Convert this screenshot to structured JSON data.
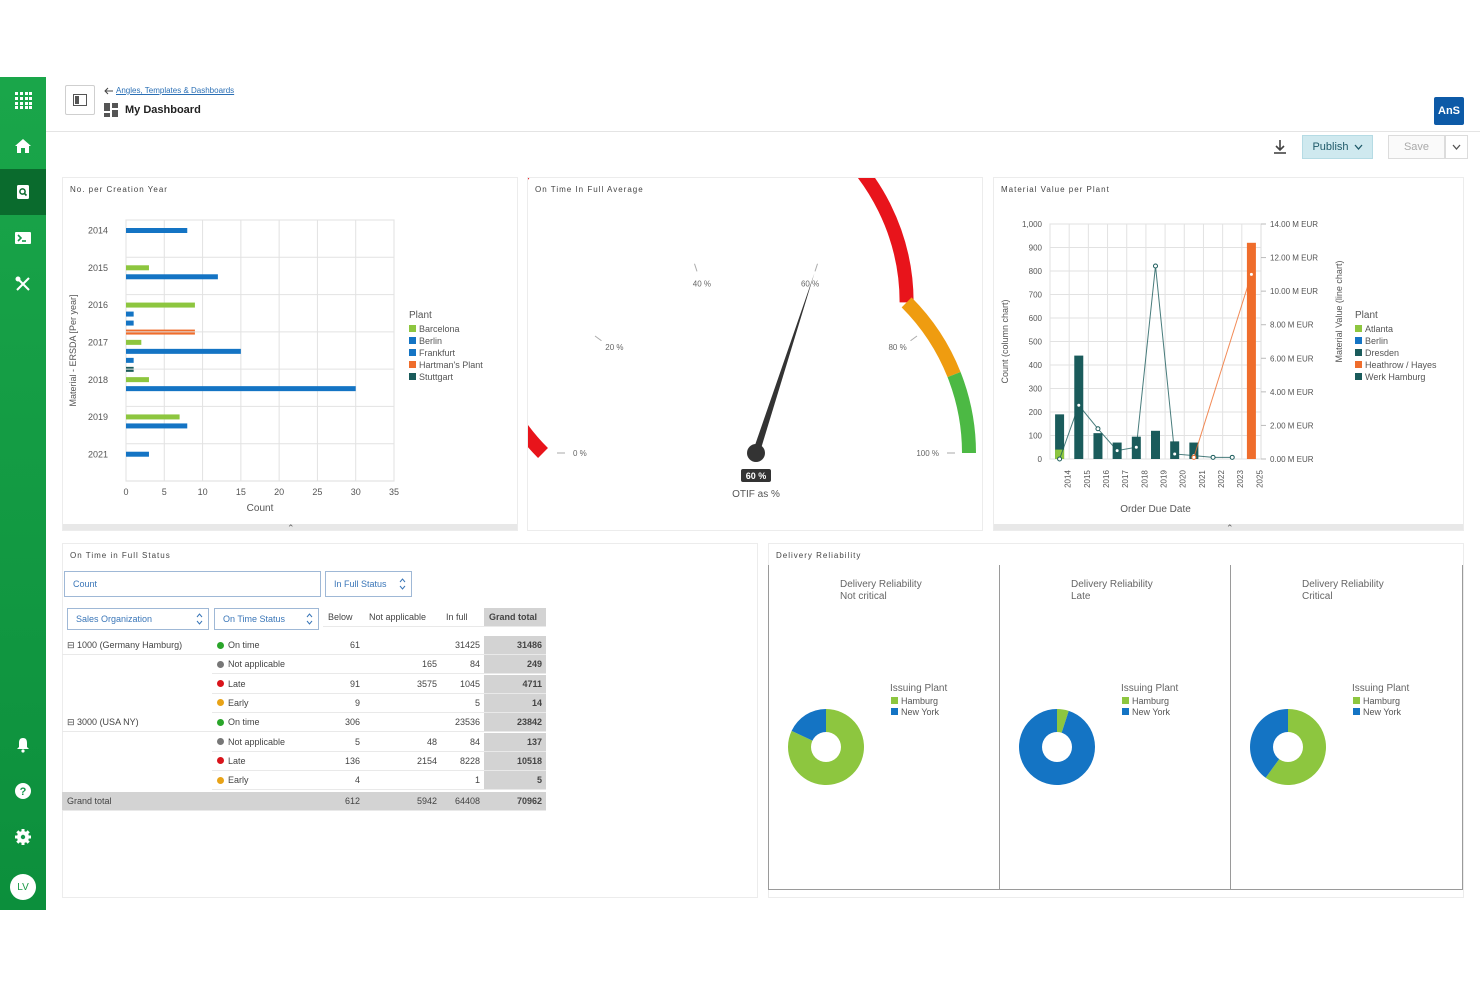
{
  "header": {
    "breadcrumb": "Angles, Templates & Dashboards",
    "title": "My Dashboard",
    "badge": "AnS"
  },
  "toolbar": {
    "publish_label": "Publish",
    "save_label": "Save"
  },
  "sidebar": {
    "avatar": "LV"
  },
  "colors": {
    "brand_green": "#1aa64a",
    "bar_green": "#8dc63f",
    "bar_blue": "#1474c4",
    "bar_orange": "#ef6d2c",
    "bar_teal": "#1a5b5b",
    "gauge_red": "#e8141b",
    "gauge_orange": "#ef9c10",
    "gauge_green": "#4cb944"
  },
  "panels": {
    "creation_year": "No. per Creation Year",
    "otif_avg": "On Time In Full Average",
    "material_value": "Material Value per Plant",
    "otif_status": "On Time in Full Status",
    "delivery_reliability": "Delivery Reliability"
  },
  "chart_data": [
    {
      "type": "bar",
      "orientation": "horizontal",
      "title": "No. per Creation Year",
      "xlabel": "Count",
      "ylabel": "Material - ERSDA [Per year]",
      "xlim": [
        0,
        35
      ],
      "xticks": [
        "0",
        "5",
        "10",
        "15",
        "20",
        "25",
        "30",
        "35"
      ],
      "categories": [
        "2014",
        "2015",
        "2016",
        "2017",
        "2018",
        "2019",
        "2021"
      ],
      "legend_title": "Plant",
      "legend": [
        "Barcelona",
        "Berlin",
        "Frankfurt",
        "Hartman's Plant",
        "Stuttgart"
      ],
      "series": [
        {
          "name": "Barcelona",
          "color": "#8dc63f",
          "values": [
            null,
            3,
            9,
            2,
            3,
            7,
            null
          ]
        },
        {
          "name": "Berlin",
          "color": "#1474c4",
          "values": [
            8,
            12,
            1,
            15,
            30,
            8,
            3
          ]
        },
        {
          "name": "Frankfurt",
          "color": "#1474c4",
          "values": [
            null,
            null,
            1,
            1,
            null,
            null,
            null
          ]
        },
        {
          "name": "Hartman's Plant",
          "color": "#ef6d2c",
          "values": [
            null,
            null,
            9,
            null,
            null,
            null,
            null
          ]
        },
        {
          "name": "Stuttgart",
          "color": "#1a5b5b",
          "values": [
            null,
            null,
            null,
            1,
            null,
            null,
            null
          ]
        }
      ]
    },
    {
      "type": "gauge",
      "title": "On Time In Full Average",
      "value": 60,
      "value_label": "60 %",
      "caption": "OTIF as %",
      "ticks": [
        "0 %",
        "20 %",
        "40 %",
        "60 %",
        "80 %",
        "100 %"
      ],
      "bands": [
        {
          "from": 0,
          "to": 75,
          "color": "#e8141b"
        },
        {
          "from": 75,
          "to": 88,
          "color": "#ef9c10"
        },
        {
          "from": 88,
          "to": 100,
          "color": "#4cb944"
        }
      ]
    },
    {
      "type": "bar",
      "combo": "column+line",
      "title": "Material Value per Plant",
      "xlabel": "Order Due Date",
      "ylabel": "Count (column chart)",
      "y2label": "Material Value (line chart)",
      "ylim": [
        0,
        1000
      ],
      "yticks": [
        "0",
        "100",
        "200",
        "300",
        "400",
        "500",
        "600",
        "700",
        "800",
        "900",
        "1,000"
      ],
      "y2ticks": [
        "0.00 M EUR",
        "2.00 M EUR",
        "4.00 M EUR",
        "6.00 M EUR",
        "8.00 M EUR",
        "10.00 M EUR",
        "12.00 M EUR",
        "14.00 M EUR"
      ],
      "categories": [
        "2014",
        "2015",
        "2016",
        "2017",
        "2018",
        "2019",
        "2020",
        "2021",
        "2022",
        "2023",
        "2025"
      ],
      "legend_title": "Plant",
      "legend": [
        "Atlanta",
        "Berlin",
        "Dresden",
        "Heathrow / Hayes",
        "Werk Hamburg"
      ],
      "columns": [
        {
          "name": "Werk Hamburg",
          "color": "#1a5b5b",
          "values": [
            190,
            440,
            110,
            70,
            95,
            120,
            75,
            70,
            0,
            0,
            0
          ]
        },
        {
          "name": "Atlanta",
          "color": "#8dc63f",
          "values": [
            40,
            0,
            0,
            0,
            0,
            0,
            0,
            0,
            0,
            0,
            0
          ]
        },
        {
          "name": "Heathrow / Hayes",
          "color": "#ef6d2c",
          "values": [
            0,
            0,
            0,
            0,
            0,
            0,
            0,
            0,
            0,
            0,
            920
          ]
        }
      ],
      "lines": [
        {
          "name": "Werk Hamburg",
          "color": "#1a5b5b",
          "values_meur": [
            0,
            3.2,
            1.8,
            0.5,
            0.7,
            11.5,
            0.3,
            0.2,
            0.1,
            0.1,
            null
          ]
        },
        {
          "name": "Heathrow / Hayes",
          "color": "#ef6d2c",
          "values_meur": [
            null,
            null,
            null,
            null,
            null,
            null,
            null,
            0.1,
            null,
            null,
            11
          ]
        }
      ]
    },
    {
      "type": "pie",
      "title": "Delivery Reliability Not critical",
      "legend_title": "Issuing Plant",
      "legend": [
        "Hamburg",
        "New York"
      ],
      "values": [
        82,
        18
      ]
    },
    {
      "type": "pie",
      "title": "Delivery Reliability Late",
      "legend_title": "Issuing Plant",
      "legend": [
        "Hamburg",
        "New York"
      ],
      "values": [
        5,
        95
      ]
    },
    {
      "type": "pie",
      "title": "Delivery Reliability Critical",
      "legend_title": "Issuing Plant",
      "legend": [
        "Hamburg",
        "New York"
      ],
      "values": [
        60,
        40
      ]
    }
  ],
  "pivot": {
    "data_field": "Count",
    "column_field": "In Full Status",
    "row_fields": [
      "Sales Organization",
      "On Time Status"
    ],
    "columns": [
      "Below",
      "Not applicable",
      "In full",
      "Grand total"
    ],
    "groups": [
      {
        "label": "1000 (Germany Hamburg)",
        "rows": [
          {
            "status": "On time",
            "color": "#2aa52a",
            "values": [
              "61",
              "",
              "31425",
              "31486"
            ]
          },
          {
            "status": "Not applicable",
            "color": "#777777",
            "values": [
              "",
              "165",
              "84",
              "249"
            ]
          },
          {
            "status": "Late",
            "color": "#d9141b",
            "values": [
              "91",
              "3575",
              "1045",
              "4711"
            ]
          },
          {
            "status": "Early",
            "color": "#e8a317",
            "values": [
              "9",
              "",
              "5",
              "14"
            ]
          }
        ]
      },
      {
        "label": "3000 (USA NY)",
        "rows": [
          {
            "status": "On time",
            "color": "#2aa52a",
            "values": [
              "306",
              "",
              "23536",
              "23842"
            ]
          },
          {
            "status": "Not applicable",
            "color": "#777777",
            "values": [
              "5",
              "48",
              "84",
              "137"
            ]
          },
          {
            "status": "Late",
            "color": "#d9141b",
            "values": [
              "136",
              "2154",
              "8228",
              "10518"
            ]
          },
          {
            "status": "Early",
            "color": "#e8a317",
            "values": [
              "4",
              "",
              "1",
              "5"
            ]
          }
        ]
      }
    ],
    "grand_total_label": "Grand total",
    "grand_total": [
      "612",
      "5942",
      "64408",
      "70962"
    ]
  }
}
